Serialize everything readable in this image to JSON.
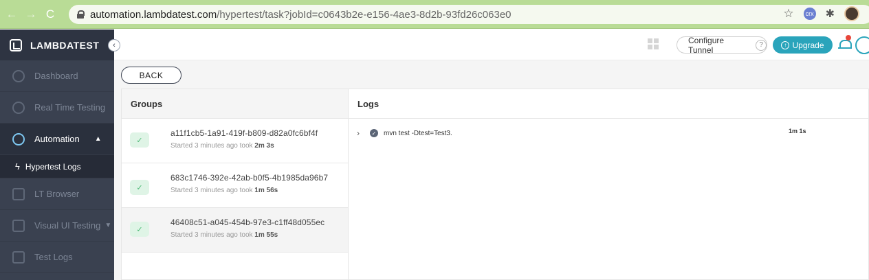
{
  "browser": {
    "url_host": "automation.lambdatest.com",
    "url_path": "/hypertest/task?jobId=c0643b2e-e156-4ae3-8d2b-93fd26c063e0",
    "ext_label": "crx"
  },
  "brand": {
    "name": "LAMBDATEST"
  },
  "sidebar": {
    "items": [
      {
        "label": "Dashboard"
      },
      {
        "label": "Real Time Testing"
      },
      {
        "label": "Automation"
      },
      {
        "label": "Hypertest Logs"
      },
      {
        "label": "LT Browser"
      },
      {
        "label": "Visual UI Testing"
      },
      {
        "label": "Test Logs"
      }
    ]
  },
  "header": {
    "configure_tunnel": "Configure Tunnel",
    "help": "?",
    "upgrade": "Upgrade"
  },
  "main": {
    "back": "BACK",
    "groups_title": "Groups",
    "logs_title": "Logs",
    "groups": [
      {
        "id": "a11f1cb5-1a91-419f-b809-d82a0fc6bf4f",
        "meta": "Started 3 minutes ago took ",
        "duration": "2m 3s"
      },
      {
        "id": "683c1746-392e-42ab-b0f5-4b1985da96b7",
        "meta": "Started 3 minutes ago took ",
        "duration": "1m 56s"
      },
      {
        "id": "46408c51-a045-454b-97e3-c1ff48d055ec",
        "meta": "Started 3 minutes ago took ",
        "duration": "1m 55s"
      }
    ],
    "logs": [
      {
        "command": "mvn test -Dtest=Test3.",
        "time": "1m 1s"
      }
    ]
  },
  "colors": {
    "accent": "#2aa4bb",
    "sidebar": "#3a4150",
    "chrome": "#b9dc96",
    "success": "#49b873"
  }
}
